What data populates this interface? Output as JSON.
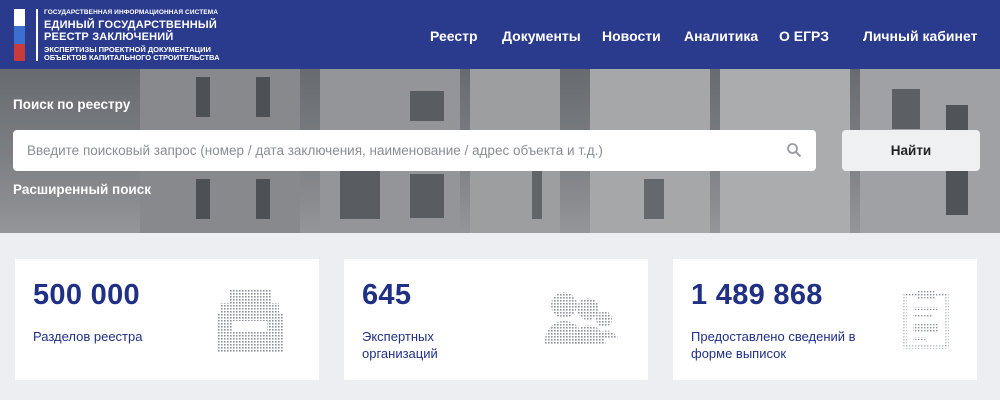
{
  "header": {
    "logo": {
      "line1": "Государственная информационная система",
      "line2": "Единый государственный",
      "line3": "реестр заключений",
      "line4": "экспертизы проектной документации",
      "line5": "объектов капитального строительства"
    },
    "nav": [
      "Реестр",
      "Документы",
      "Новости",
      "Аналитика",
      "О ЕГРЗ",
      "Личный кабинет"
    ]
  },
  "hero": {
    "label": "Поиск по реестру",
    "search_placeholder": "Введите поисковый запрос (номер / дата заключения, наименование / адрес объекта и т.д.)",
    "search_value": "",
    "find_button": "Найти",
    "advanced_link": "Расширенный поиск"
  },
  "stats": [
    {
      "number": "500 000",
      "caption": "Разделов реестра",
      "icon": "archive-icon"
    },
    {
      "number": "645",
      "caption": "Экспертных организаций",
      "icon": "people-icon"
    },
    {
      "number": "1 489 868",
      "caption": "Предоставлено сведений в форме выписок",
      "icon": "document-icon"
    }
  ],
  "colors": {
    "header_bg": "#2a3a8c",
    "accent_text": "#1f3085",
    "page_bg": "#eceef1"
  }
}
